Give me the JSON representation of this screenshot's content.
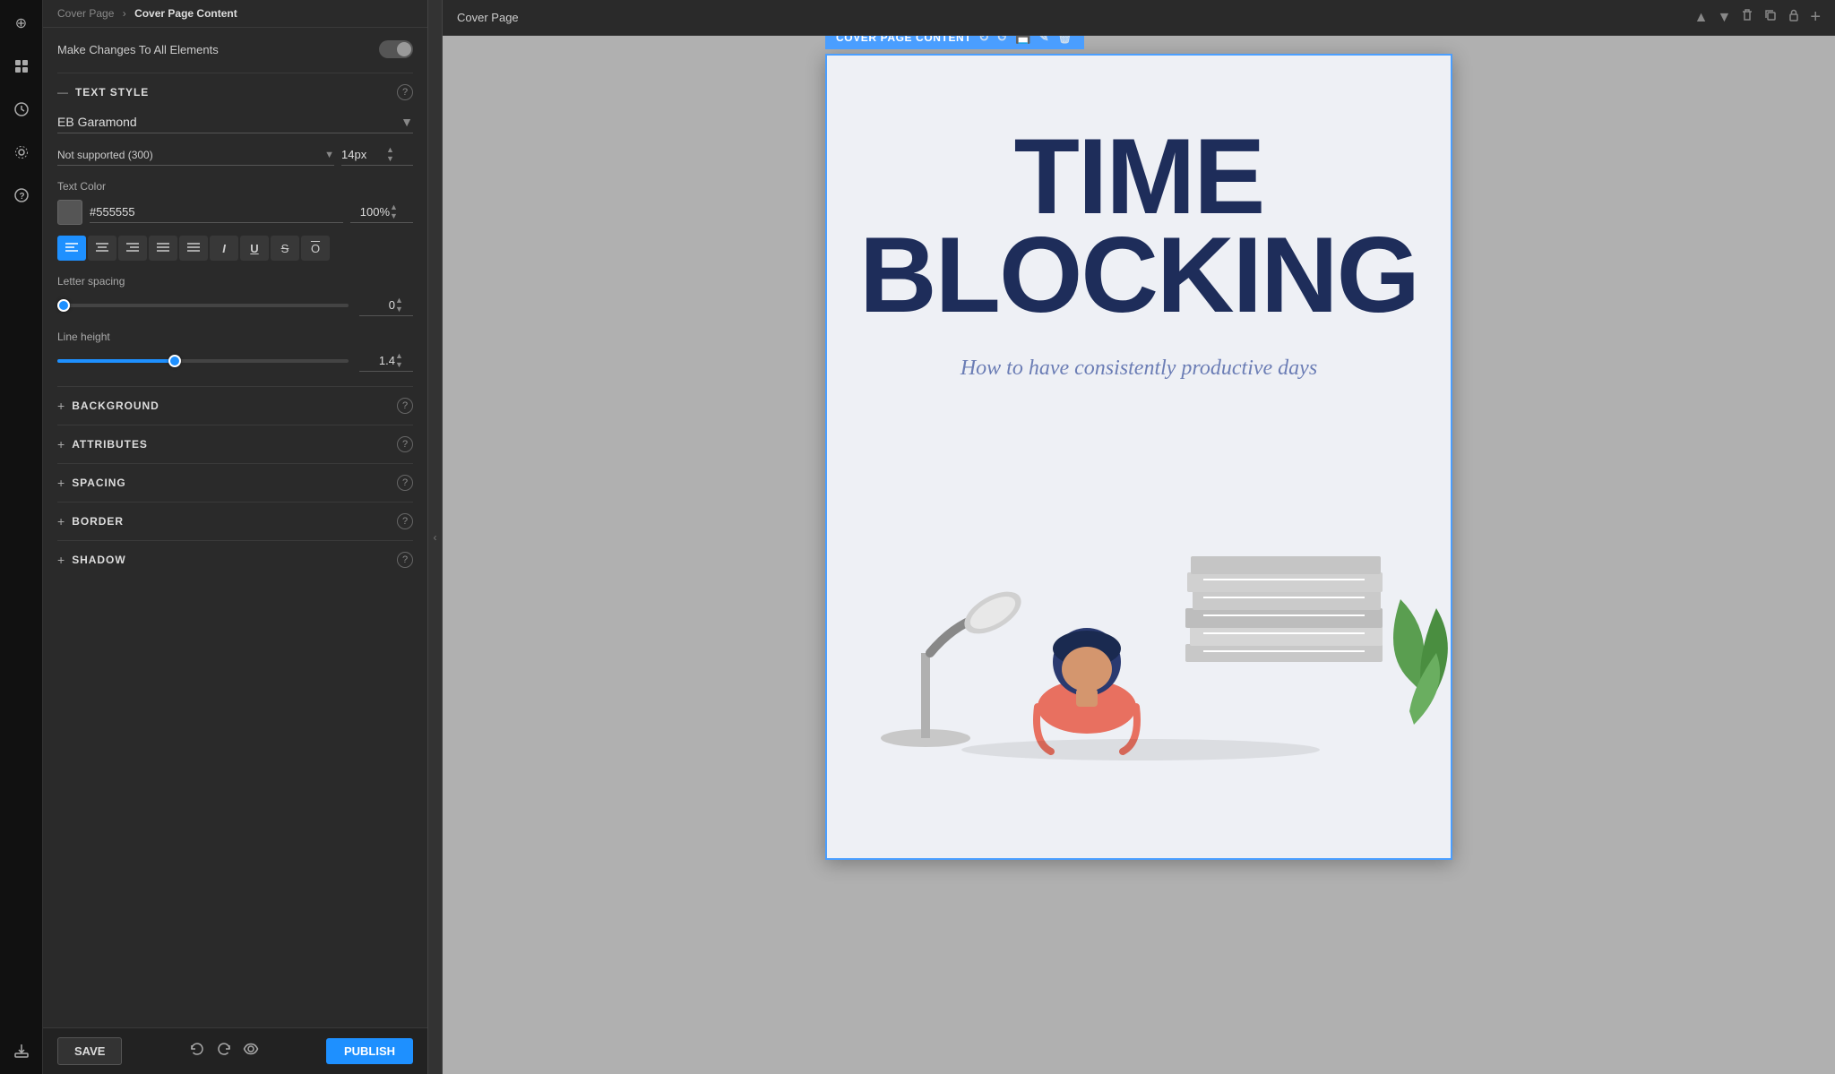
{
  "breadcrumb": {
    "parent": "Cover Page",
    "current": "Cover Page Content",
    "separator": "›"
  },
  "make_changes": {
    "label": "Make Changes To All Elements"
  },
  "text_style": {
    "section_title": "TEXT STYLE",
    "font_family": "EB Garamond",
    "font_weight": "Not supported (300)",
    "font_size": "14px",
    "text_color_label": "Text Color",
    "color_hex": "#555555",
    "opacity": "100%",
    "letter_spacing_label": "Letter spacing",
    "letter_spacing_value": "0",
    "line_height_label": "Line height",
    "line_height_value": "1.4"
  },
  "format_buttons": [
    {
      "id": "align-left",
      "symbol": "≡",
      "label": "Align Left",
      "active": true
    },
    {
      "id": "align-center",
      "symbol": "≡",
      "label": "Align Center",
      "active": false
    },
    {
      "id": "align-right",
      "symbol": "≡",
      "label": "Align Right",
      "active": false
    },
    {
      "id": "align-justify-left",
      "symbol": "≡",
      "label": "Align Justify Left",
      "active": false
    },
    {
      "id": "align-justify",
      "symbol": "≡",
      "label": "Justify",
      "active": false
    },
    {
      "id": "italic",
      "symbol": "I",
      "label": "Italic",
      "active": false
    },
    {
      "id": "underline",
      "symbol": "U",
      "label": "Underline",
      "active": false
    },
    {
      "id": "strikethrough",
      "symbol": "S",
      "label": "Strikethrough",
      "active": false
    },
    {
      "id": "overline",
      "symbol": "O",
      "label": "Overline",
      "active": false
    }
  ],
  "sections": {
    "background": {
      "title": "BACKGROUND"
    },
    "attributes": {
      "title": "ATTRIBUTES"
    },
    "spacing": {
      "title": "SPACING"
    },
    "border": {
      "title": "BORDER"
    },
    "shadow": {
      "title": "SHADOW"
    }
  },
  "toolbar": {
    "save_label": "SAVE",
    "publish_label": "PUBLISH"
  },
  "canvas": {
    "page_title": "Cover Page",
    "content_label": "COVER PAGE CONTENT"
  },
  "cover_page": {
    "main_title_line1": "TIME",
    "main_title_line2": "BLOCKING",
    "subtitle": "How to have consistently productive days"
  },
  "icon_bar": [
    {
      "id": "add",
      "symbol": "⊕"
    },
    {
      "id": "pages",
      "symbol": "⊞"
    },
    {
      "id": "history",
      "symbol": "🕐"
    },
    {
      "id": "settings",
      "symbol": "⚙"
    },
    {
      "id": "help",
      "symbol": "?"
    },
    {
      "id": "export",
      "symbol": "⬆"
    }
  ]
}
